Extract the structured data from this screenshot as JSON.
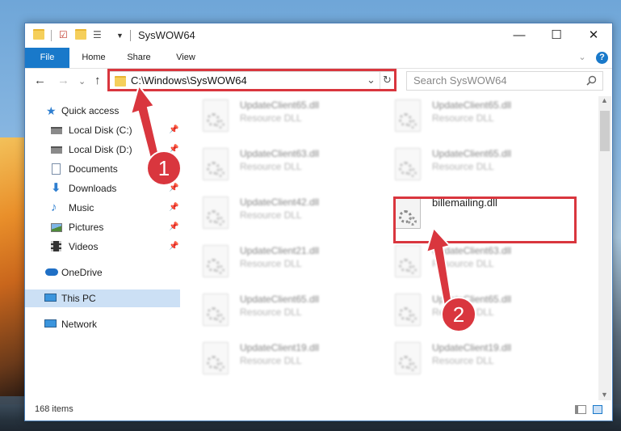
{
  "window": {
    "title": "SysWOW64",
    "minimize": "—",
    "maximize": "☐",
    "close": "✕"
  },
  "ribbon": {
    "tabs": [
      "File",
      "Home",
      "Share",
      "View"
    ],
    "collapse": "⌄",
    "help": "?"
  },
  "nav": {
    "back": "←",
    "forward": "→",
    "recent": "⌄",
    "up": "↑",
    "address": "C:\\Windows\\SysWOW64",
    "dropdown": "⌄",
    "refresh": "↻",
    "search_placeholder": "Search SysWOW64"
  },
  "sidebar": {
    "items": [
      {
        "label": "Quick access",
        "icon": "star-icon",
        "pinned": false
      },
      {
        "label": "Local Disk (C:)",
        "icon": "drive-icon",
        "pinned": true
      },
      {
        "label": "Local Disk (D:)",
        "icon": "drive-icon",
        "pinned": true
      },
      {
        "label": "Documents",
        "icon": "documents-icon",
        "pinned": true
      },
      {
        "label": "Downloads",
        "icon": "download-icon",
        "pinned": true
      },
      {
        "label": "Music",
        "icon": "music-icon",
        "pinned": true
      },
      {
        "label": "Pictures",
        "icon": "pictures-icon",
        "pinned": true
      },
      {
        "label": "Videos",
        "icon": "videos-icon",
        "pinned": true
      },
      {
        "label": "OneDrive",
        "icon": "cloud-icon",
        "pinned": false
      },
      {
        "label": "This PC",
        "icon": "computer-icon",
        "pinned": false,
        "selected": true
      },
      {
        "label": "Network",
        "icon": "network-icon",
        "pinned": false
      }
    ]
  },
  "files": [
    {
      "name": "UpdateClient65.dll",
      "type": "Resource DLL",
      "blurred": true
    },
    {
      "name": "UpdateClient65.dll",
      "type": "Resource DLL",
      "blurred": true
    },
    {
      "name": "UpdateClient63.dll",
      "type": "Resource DLL",
      "blurred": true
    },
    {
      "name": "UpdateClient65.dll",
      "type": "Resource DLL",
      "blurred": true
    },
    {
      "name": "UpdateClient42.dll",
      "type": "Resource DLL",
      "blurred": true
    },
    {
      "name": "billemailing.dll",
      "type": "",
      "blurred": false,
      "highlighted": true
    },
    {
      "name": "UpdateClient21.dll",
      "type": "Resource DLL",
      "blurred": true
    },
    {
      "name": "UpdateClient63.dll",
      "type": "Resource DLL",
      "blurred": true
    },
    {
      "name": "UpdateClient65.dll",
      "type": "Resource DLL",
      "blurred": true
    },
    {
      "name": "UpdateClient65.dll",
      "type": "Resource DLL",
      "blurred": true
    },
    {
      "name": "UpdateClient19.dll",
      "type": "Resource DLL",
      "blurred": true
    },
    {
      "name": "UpdateClient19.dll",
      "type": "Resource DLL",
      "blurred": true
    }
  ],
  "status": {
    "count": "168 items"
  },
  "annotations": {
    "step1": "1",
    "step2": "2",
    "color": "#d9363e"
  }
}
